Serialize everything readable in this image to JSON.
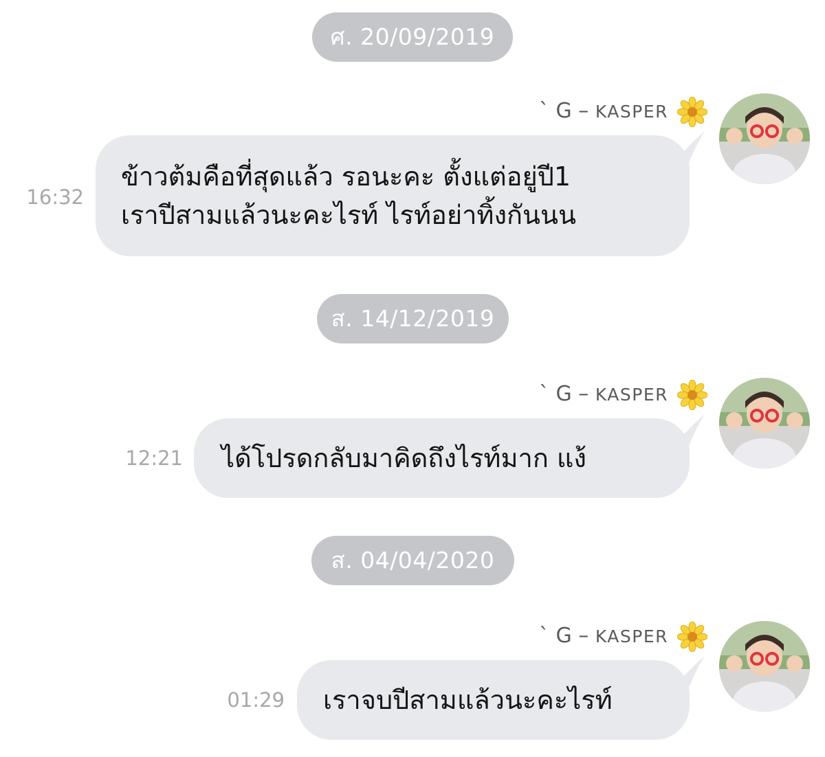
{
  "contact": {
    "name_prefix": "` G – ",
    "name_main": "KASPER",
    "avatar_icon": "avatar-photo",
    "badge_icon": "sunflower-icon"
  },
  "colors": {
    "background": "#ffffff",
    "date_pill": "#c5c6c9",
    "bubble": "#e8e9ec",
    "timestamp": "#a7a8ab",
    "message_text": "#141414"
  },
  "messages": [
    {
      "date": "ศ. 20/09/2019",
      "time": "16:32",
      "text": "ข้าวต้มคือที่สุดแล้ว รอนะคะ ตั้งแต่อยู่ปี1\nเราปีสามแล้วนะคะไรท์ ไรท์อย่าทิ้งกันนน"
    },
    {
      "date": "ส. 14/12/2019",
      "time": "12:21",
      "text": "ได้โปรดกลับมาคิดถึงไรท์มาก แง้"
    },
    {
      "date": "ส. 04/04/2020",
      "time": "01:29",
      "text": "เราจบปีสามแล้วนะคะไรท์"
    }
  ]
}
